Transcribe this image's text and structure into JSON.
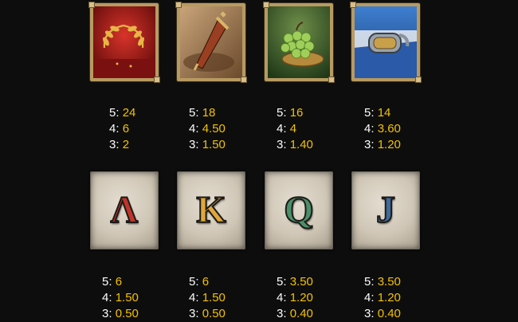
{
  "colors": {
    "background": "#0d0d0d",
    "count_text": "#ffffff",
    "value_text": "#f2c200",
    "frame": "#b79a62"
  },
  "symbols": [
    {
      "icon": "laurel-wreath-icon",
      "pays": [
        {
          "count": "5:",
          "value": "24"
        },
        {
          "count": "4:",
          "value": "6"
        },
        {
          "count": "3:",
          "value": "2"
        }
      ]
    },
    {
      "icon": "gladius-sword-icon",
      "pays": [
        {
          "count": "5:",
          "value": "18"
        },
        {
          "count": "4:",
          "value": "4.50"
        },
        {
          "count": "3:",
          "value": "1.50"
        }
      ]
    },
    {
      "icon": "grapes-icon",
      "pays": [
        {
          "count": "5:",
          "value": "16"
        },
        {
          "count": "4:",
          "value": "4"
        },
        {
          "count": "3:",
          "value": "1.40"
        }
      ]
    },
    {
      "icon": "bracer-icon",
      "pays": [
        {
          "count": "5:",
          "value": "14"
        },
        {
          "count": "4:",
          "value": "3.60"
        },
        {
          "count": "3:",
          "value": "1.20"
        }
      ]
    },
    {
      "icon": "letter-a-icon",
      "letter": "Λ",
      "color": "#c0342a",
      "pays": [
        {
          "count": "5:",
          "value": "6"
        },
        {
          "count": "4:",
          "value": "1.50"
        },
        {
          "count": "3:",
          "value": "0.50"
        }
      ]
    },
    {
      "icon": "letter-k-icon",
      "letter": "K",
      "color": "#e0a73c",
      "pays": [
        {
          "count": "5:",
          "value": "6"
        },
        {
          "count": "4:",
          "value": "1.50"
        },
        {
          "count": "3:",
          "value": "0.50"
        }
      ]
    },
    {
      "icon": "letter-q-icon",
      "letter": "Q",
      "color": "#4a8f6a",
      "pays": [
        {
          "count": "5:",
          "value": "3.50"
        },
        {
          "count": "4:",
          "value": "1.20"
        },
        {
          "count": "3:",
          "value": "0.40"
        }
      ]
    },
    {
      "icon": "letter-j-icon",
      "letter": "J",
      "color": "#3f6a9c",
      "pays": [
        {
          "count": "5:",
          "value": "3.50"
        },
        {
          "count": "4:",
          "value": "1.20"
        },
        {
          "count": "3:",
          "value": "0.40"
        }
      ]
    }
  ]
}
